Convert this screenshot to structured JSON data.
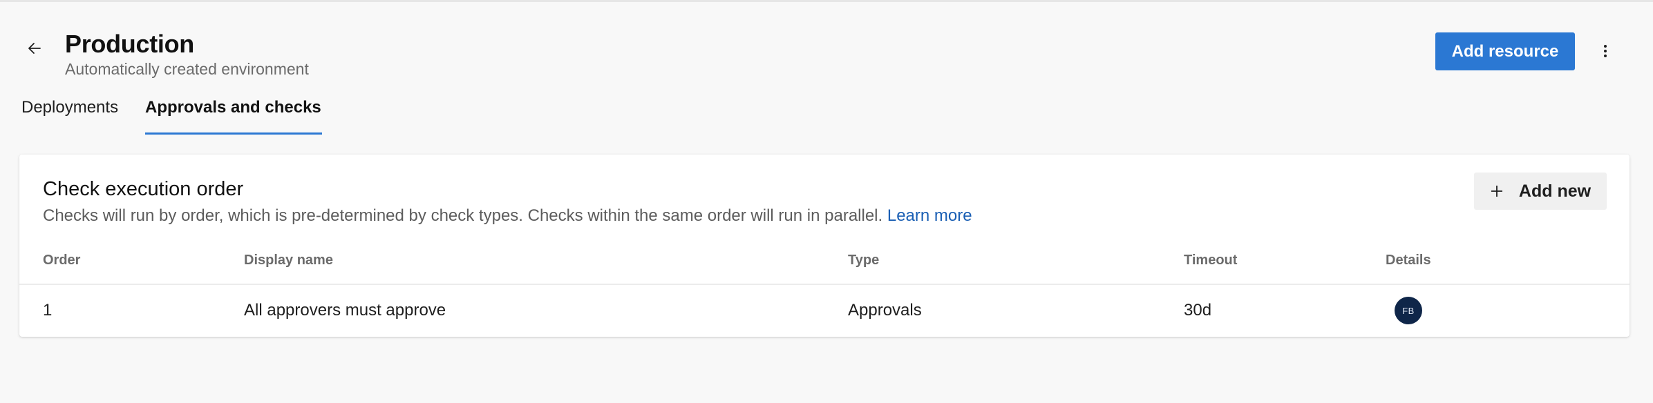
{
  "header": {
    "title": "Production",
    "subtitle": "Automatically created environment",
    "add_resource_label": "Add resource",
    "back_icon": "arrow-left-icon",
    "more_icon": "more-vertical-icon"
  },
  "tabs": [
    {
      "label": "Deployments",
      "selected": false
    },
    {
      "label": "Approvals and checks",
      "selected": true
    }
  ],
  "card": {
    "title": "Check execution order",
    "description": "Checks will run by order, which is pre-determined by check types. Checks within the same order will run in parallel.",
    "learn_more": "Learn more",
    "add_new_label": "Add new",
    "add_icon": "plus-icon",
    "columns": [
      "Order",
      "Display name",
      "Type",
      "Timeout",
      "Details"
    ],
    "rows": [
      {
        "order": "1",
        "display_name": "All approvers must approve",
        "type": "Approvals",
        "timeout": "30d",
        "details_avatar": "FB"
      }
    ]
  },
  "colors": {
    "accent": "#2b78d3",
    "link": "#1a5fb4",
    "avatar_bg": "#0f2649",
    "background": "#f8f8f8"
  }
}
